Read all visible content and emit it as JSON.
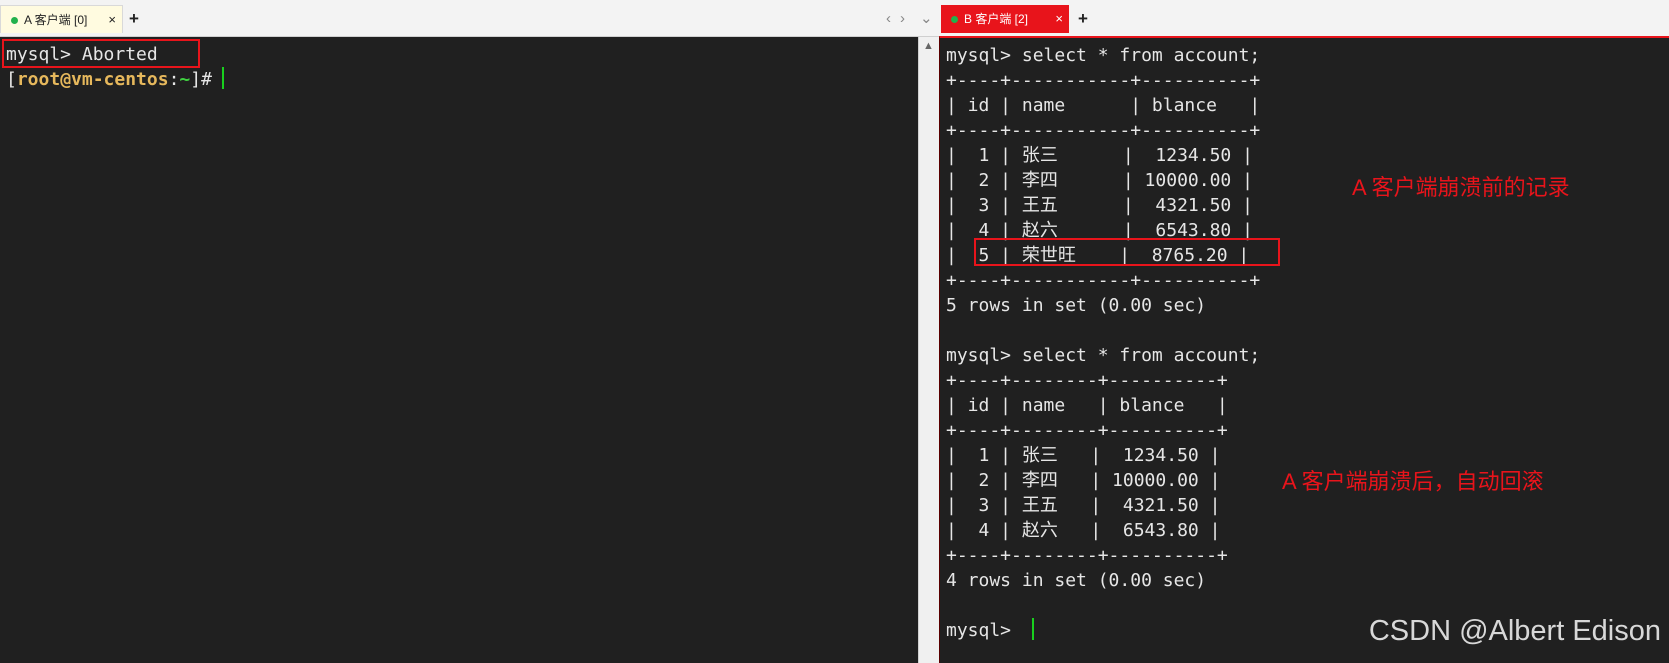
{
  "left_pane": {
    "tab": {
      "label": "A 客户端 [0]",
      "close": "×",
      "add": "+"
    },
    "nav": {
      "prev": "‹",
      "next": "›",
      "dropdown": "⌄"
    },
    "lines": [
      "mysql> Aborted"
    ],
    "shell_prompt": {
      "open": "[",
      "user_host": "root@vm-centos",
      "colon": ":",
      "path": "~",
      "close": "]#"
    }
  },
  "right_pane": {
    "tab": {
      "label": "B 客户端 [2]",
      "close": "×",
      "add": "+"
    },
    "lines": [
      "mysql> select * from account;",
      "+----+-----------+----------+",
      "| id | name      | blance   |",
      "+----+-----------+----------+",
      "|  1 | 张三      |  1234.50 |",
      "|  2 | 李四      | 10000.00 |",
      "|  3 | 王五      |  4321.50 |",
      "|  4 | 赵六      |  6543.80 |",
      "|  5 | 荣世旺    |  8765.20 |",
      "+----+-----------+----------+",
      "5 rows in set (0.00 sec)",
      "",
      "mysql> select * from account;",
      "+----+--------+----------+",
      "| id | name   | blance   |",
      "+----+--------+----------+",
      "|  1 | 张三   |  1234.50 |",
      "|  2 | 李四   | 10000.00 |",
      "|  3 | 王五   |  4321.50 |",
      "|  4 | 赵六   |  6543.80 |",
      "+----+--------+----------+",
      "4 rows in set (0.00 sec)",
      "",
      "mysql> "
    ]
  },
  "annotations": {
    "before": "A 客户端崩溃前的记录",
    "after": "A 客户端崩溃后，自动回滚"
  },
  "watermark": "CSDN @Albert Edison",
  "colors": {
    "terminal_bg": "#202020",
    "accent_red": "#e8141b",
    "cursor_green": "#19d01e",
    "prompt_user": "#e6b85c",
    "prompt_path": "#3fd040"
  }
}
